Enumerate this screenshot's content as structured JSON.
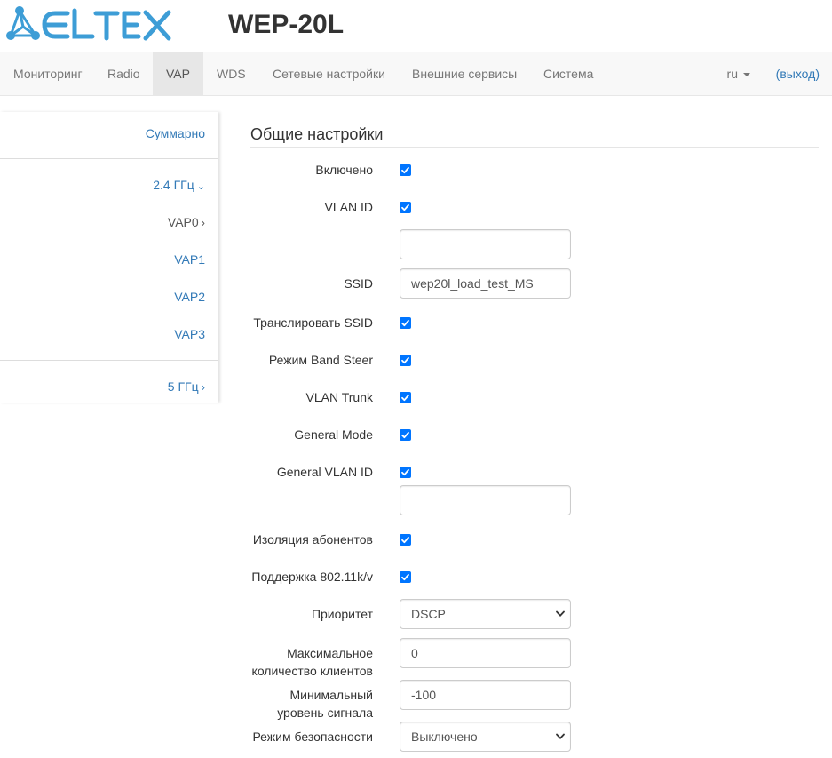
{
  "brand": {
    "logo_text": "ELTEX",
    "device_model": "WEP-20L",
    "logo_color": "#3d9dd6"
  },
  "nav": {
    "items": [
      "Мониторинг",
      "Radio",
      "VAP",
      "WDS",
      "Сетевые настройки",
      "Внешние сервисы",
      "Система"
    ],
    "active": "VAP",
    "language": "ru",
    "logout": "(выход)"
  },
  "sidebar": {
    "summary": "Суммарно",
    "band_24": "2.4 ГГц",
    "vaps": [
      "VAP0",
      "VAP1",
      "VAP2",
      "VAP3"
    ],
    "current_vap": "VAP0",
    "band_5": "5 ГГц"
  },
  "section": {
    "title": "Общие настройки"
  },
  "form": {
    "enabled_label": "Включено",
    "vlan_id_label": "VLAN ID",
    "vlan_id_value": "",
    "ssid_label": "SSID",
    "ssid_value": "wep20l_load_test_MS",
    "broadcast_ssid_label": "Транслировать SSID",
    "band_steer_label": "Режим Band Steer",
    "vlan_trunk_label": "VLAN Trunk",
    "general_mode_label": "General Mode",
    "general_vlan_id_label": "General VLAN ID",
    "general_vlan_id_value": "",
    "station_isolation_label": "Изоляция абонентов",
    "kv_support_label": "Поддержка 802.11k/v",
    "priority_label": "Приоритет",
    "priority_value": "DSCP",
    "max_clients_label_1": "Максимальное",
    "max_clients_label_2": "количество клиентов",
    "max_clients_value": "0",
    "min_signal_label_1": "Минимальный",
    "min_signal_label_2": "уровень сигнала",
    "min_signal_value": "-100",
    "security_mode_label": "Режим безопасности",
    "security_mode_value": "Выключено"
  },
  "colors": {
    "checkbox": "#0075ff",
    "link": "#337ab7",
    "nav_bg": "#f8f8f8",
    "nav_active_bg": "#e7e7e7"
  },
  "icons": {
    "caret": "caret-down-icon",
    "chevron_right": "chevron-right-icon",
    "chevron_down": "chevron-down-icon",
    "check": "check-icon"
  }
}
